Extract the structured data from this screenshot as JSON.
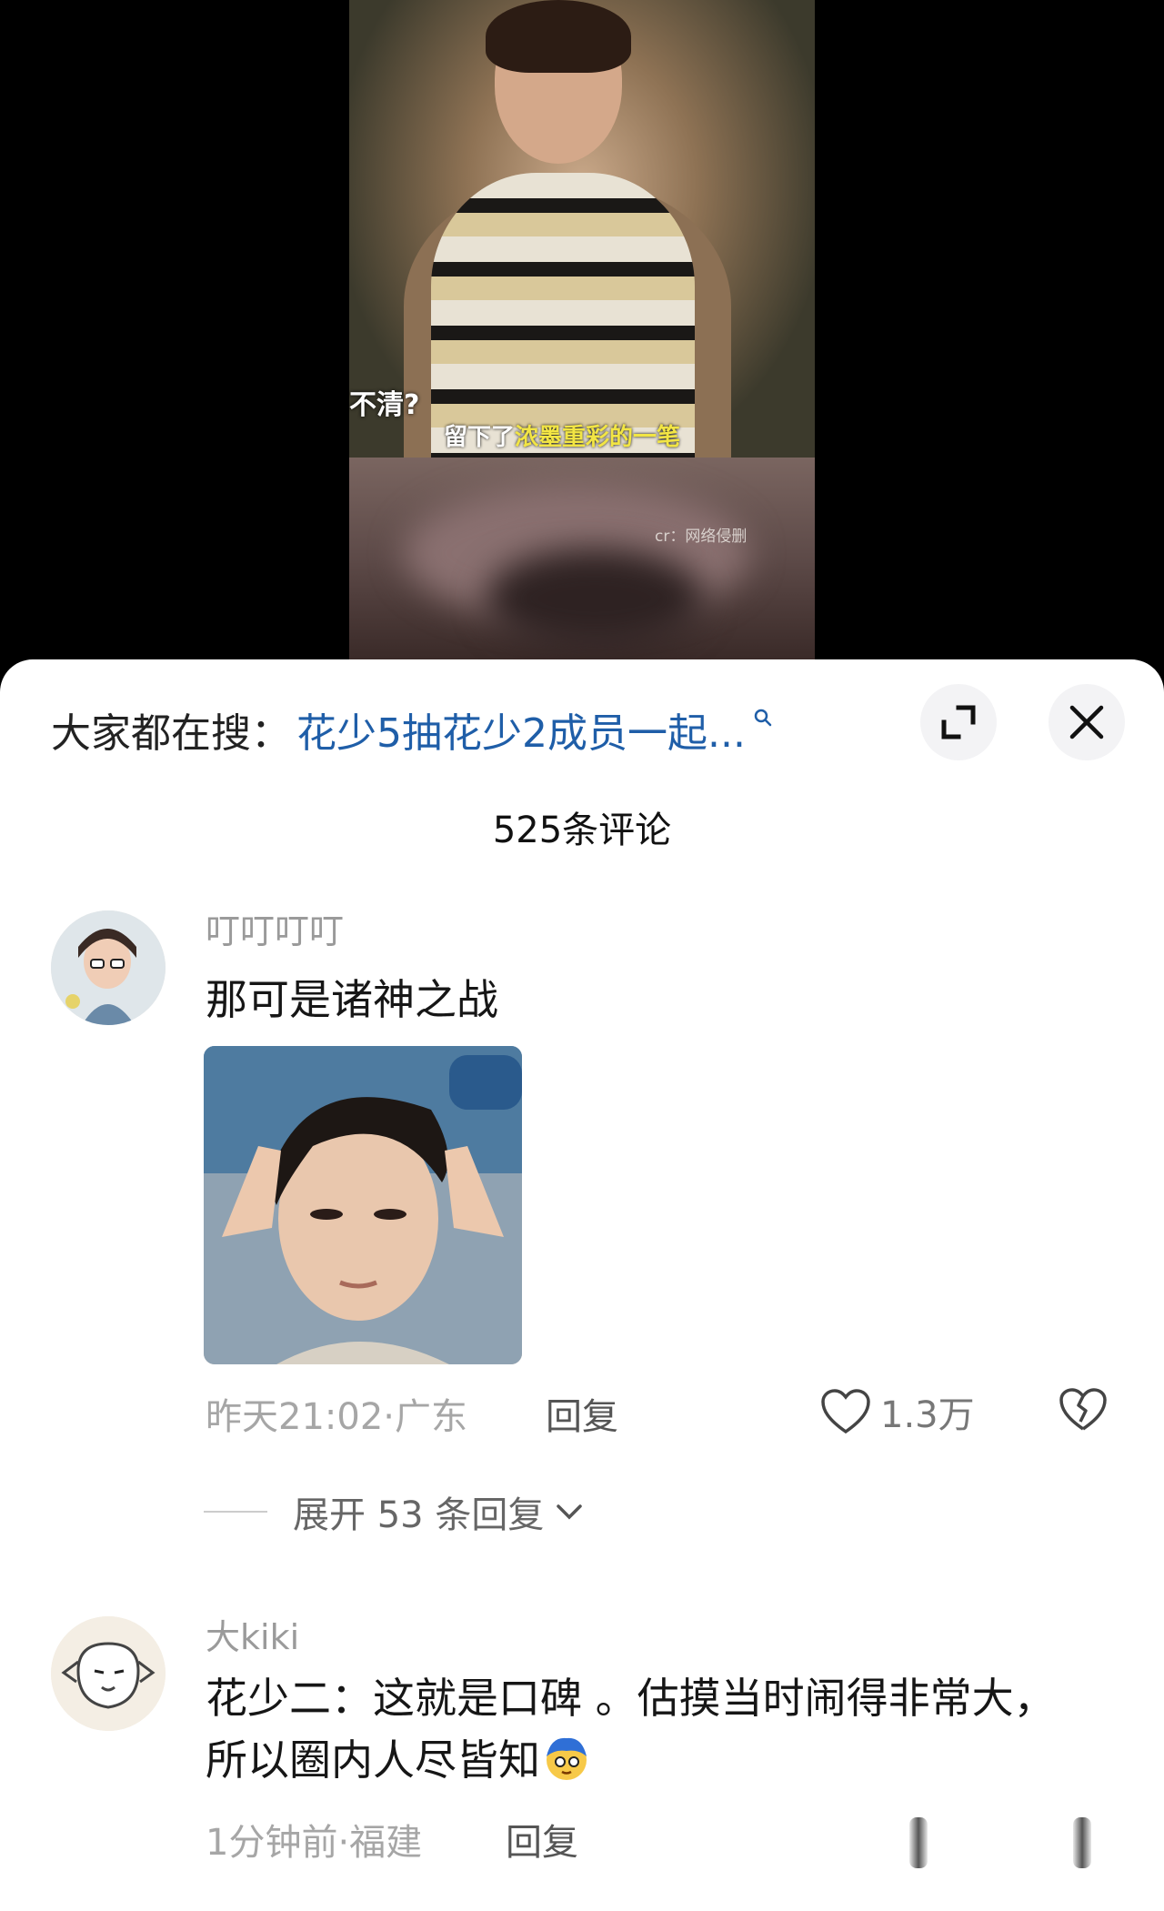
{
  "video": {
    "subtitle_left": "不清?",
    "subtitle_white": "留下了",
    "subtitle_yellow": "浓墨重彩的一笔",
    "credit": "cr：网络侵删"
  },
  "sheet": {
    "search_prefix": "大家都在搜：",
    "search_query": "花少5抽花少2成员一起...",
    "comment_count": "525条评论"
  },
  "comments": [
    {
      "username": "叮叮叮叮",
      "text": "那可是诸神之战",
      "meta": "昨天21:02·广东",
      "reply_label": "回复",
      "likes": "1.3万",
      "expand_label": "展开 53 条回复"
    },
    {
      "username": "大kiki",
      "text": "花少二：这就是口碑 。估摸当时闹得非常大，所以圈内人尽皆知",
      "meta": "1分钟前·福建",
      "reply_label": "回复"
    }
  ],
  "colors": {
    "link_blue": "#1f5ea8",
    "subtitle_yellow": "#f2e544"
  }
}
